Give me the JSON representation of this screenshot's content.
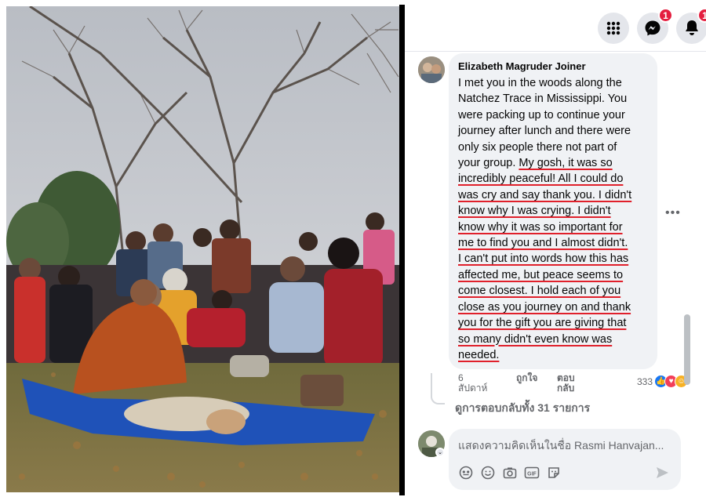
{
  "photo": {
    "alt_icon": "photo-group-prayer"
  },
  "header": {
    "messenger_badge": "1",
    "notifications_badge": "1"
  },
  "comment": {
    "author": "Elizabeth Magruder Joiner",
    "plain_lines": [
      "I met you in the woods along the",
      "Natchez Trace in Mississippi. You",
      "were packing up to continue your",
      "journey after lunch and there were",
      "only six people there not part of"
    ],
    "line6_plain": "your group. ",
    "underlined_lines": [
      "My gosh, it was so",
      "incredibly peaceful! All I could do",
      "was cry and say thank you. I didn't",
      "know why I was crying. I didn't",
      "know why it was so important for",
      "me to find you and I almost didn't.",
      "I can't put into words how this has",
      "affected me, but peace seems to",
      "come closest. I hold each of you",
      "close as you journey on and thank",
      "you for the gift you are giving that",
      "so many didn't even know was",
      "needed."
    ],
    "more_icon": "more-dots-icon"
  },
  "actions": {
    "time": "6 สัปดาห์",
    "like": "ถูกใจ",
    "reply": "ตอบกลับ",
    "reaction_count": "333",
    "reaction_colors": {
      "like": "#1877f2",
      "love": "#f33e58",
      "care": "#f7b125"
    }
  },
  "replies": {
    "view_all": "ดูการตอบกลับทั้ง 31 รายการ"
  },
  "reply_box": {
    "placeholder": "แสดงความคิดเห็นในชื่อ Rasmi Hanvajan..."
  }
}
